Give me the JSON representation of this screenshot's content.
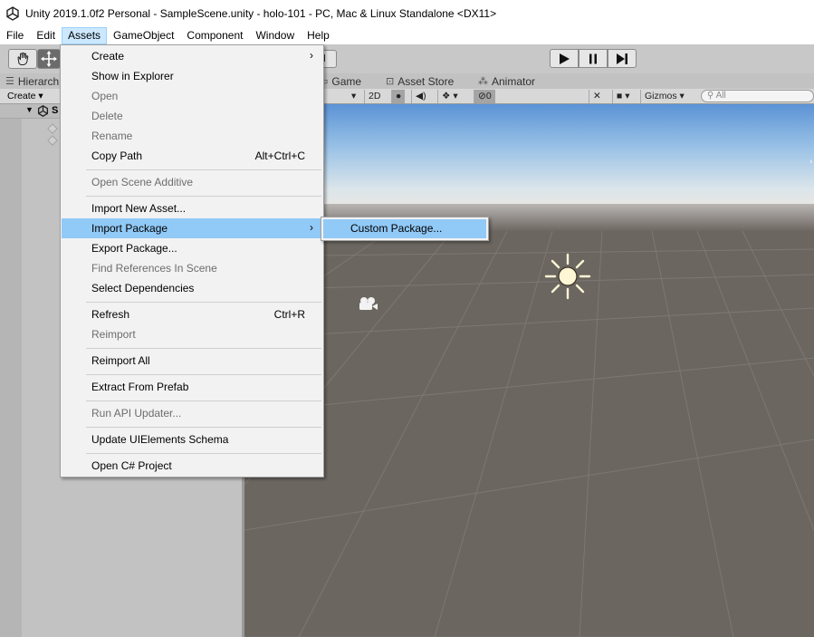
{
  "window": {
    "title": "Unity 2019.1.0f2 Personal - SampleScene.unity - holo-101 - PC, Mac & Linux Standalone <DX11>"
  },
  "menubar": {
    "items": [
      {
        "label": "File"
      },
      {
        "label": "Edit"
      },
      {
        "label": "Assets"
      },
      {
        "label": "GameObject"
      },
      {
        "label": "Component"
      },
      {
        "label": "Window"
      },
      {
        "label": "Help"
      }
    ],
    "active": "Assets"
  },
  "toolbar": {
    "tools": [
      "hand-tool",
      "move-tool"
    ],
    "pivot_partial_label": "al",
    "play_controls": [
      "play",
      "pause",
      "step"
    ]
  },
  "tabs": {
    "hierarchy_partial": "Hierarch",
    "game": "Game",
    "asset_store": "Asset Store",
    "animator": "Animator"
  },
  "hierarchy": {
    "create_label": "Create",
    "scene_partial": "S"
  },
  "scene_toolbar": {
    "mode_2d": "2D",
    "effects_count": "0",
    "gizmos_label": "Gizmos",
    "search_placeholder": "All"
  },
  "assets_menu": {
    "items": [
      {
        "label": "Create",
        "submenu": true,
        "enabled": true
      },
      {
        "label": "Show in Explorer",
        "enabled": true
      },
      {
        "label": "Open",
        "enabled": false
      },
      {
        "label": "Delete",
        "enabled": false
      },
      {
        "label": "Rename",
        "enabled": false
      },
      {
        "label": "Copy Path",
        "shortcut": "Alt+Ctrl+C",
        "enabled": true
      },
      {
        "label": "Open Scene Additive",
        "enabled": false
      },
      {
        "label": "Import New Asset...",
        "enabled": true
      },
      {
        "label": "Import Package",
        "submenu": true,
        "enabled": true,
        "highlighted": true
      },
      {
        "label": "Export Package...",
        "enabled": true
      },
      {
        "label": "Find References In Scene",
        "enabled": false
      },
      {
        "label": "Select Dependencies",
        "enabled": true
      },
      {
        "label": "Refresh",
        "shortcut": "Ctrl+R",
        "enabled": true
      },
      {
        "label": "Reimport",
        "enabled": false
      },
      {
        "label": "Reimport All",
        "enabled": true
      },
      {
        "label": "Extract From Prefab",
        "enabled": true
      },
      {
        "label": "Run API Updater...",
        "enabled": false
      },
      {
        "label": "Update UIElements Schema",
        "enabled": true
      },
      {
        "label": "Open C# Project",
        "enabled": true
      }
    ]
  },
  "import_package_submenu": {
    "items": [
      {
        "label": "Custom Package...",
        "highlighted": true
      }
    ]
  },
  "colors": {
    "menu_highlight": "#91c9f7",
    "menubar_active": "#cce8ff"
  }
}
